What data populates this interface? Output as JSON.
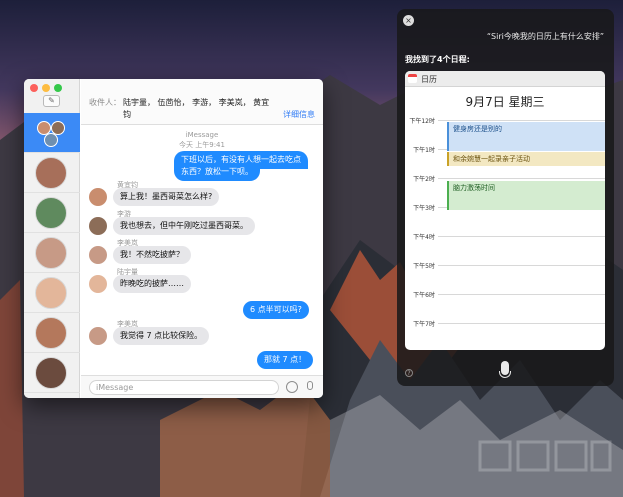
{
  "messages": {
    "compose_icon": "✎",
    "to_label": "收件人：",
    "recipients": "陆宇量，  伍茴怡，  李游，  李美岚，  黄宜钧",
    "details_link": "详细信息",
    "service_label": "iMessage",
    "timestamp": "今天 上午9:41",
    "thread": [
      {
        "dir": "out",
        "text": "下班以后，有没有人想一起去吃点"
      },
      {
        "dir": "out",
        "text": "东西？放松一下呗。"
      },
      {
        "dir": "in",
        "sender": "黄宜钧",
        "text": "算上我！墨西哥菜怎么样?"
      },
      {
        "dir": "in",
        "sender": "李游",
        "text": "我也想去，但中午刚吃过墨西哥菜。"
      },
      {
        "dir": "in",
        "sender": "李美岚",
        "text": "我！不然吃披萨？"
      },
      {
        "dir": "in",
        "sender": "陆宇量",
        "text": "昨晚吃的披萨……"
      },
      {
        "dir": "out",
        "text": "6 点半可以吗?"
      },
      {
        "dir": "in",
        "sender": "李美岚",
        "text": "我觉得 7 点比较保险。"
      },
      {
        "dir": "out",
        "text": "那就 7 点！"
      }
    ],
    "input_placeholder": "iMessage"
  },
  "siri": {
    "close_icon": "×",
    "query": "“Siri今晚我的日历上有什么安排”",
    "answer": "我找到了4个日程:",
    "calendar_app": "日历",
    "date": "9月7日 星期三",
    "hours": [
      "下午12时",
      "下午1时",
      "下午2时",
      "下午3时",
      "下午4时",
      "下午5时",
      "下午6时",
      "下午7时"
    ],
    "events": [
      "健身房还是别的",
      "和余婉慧一起录亲子活动",
      "脑力激荡时间"
    ],
    "help_icon": "?"
  },
  "colors": {
    "imessage_blue": "#1f8bff",
    "selection_blue": "#3b8af6",
    "event_blue": "#4a90d9",
    "event_yellow": "#c9a227",
    "event_green": "#4caf50"
  }
}
